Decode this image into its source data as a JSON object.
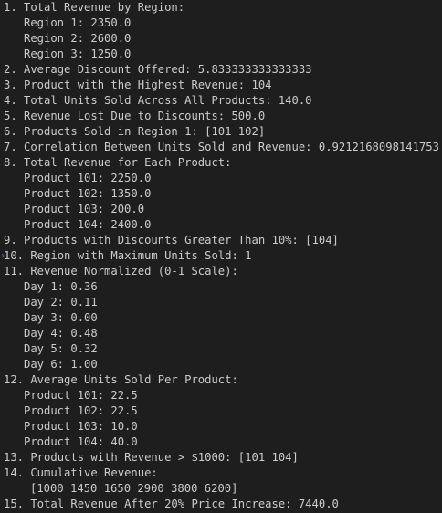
{
  "terminal": {
    "lines": [
      {
        "text": "1. Total Revenue by Region:",
        "indent": 0
      },
      {
        "text": "Region 1: 2350.0",
        "indent": 1
      },
      {
        "text": "Region 2: 2600.0",
        "indent": 1
      },
      {
        "text": "Region 3: 1250.0",
        "indent": 1
      },
      {
        "text": "2. Average Discount Offered: 5.833333333333333",
        "indent": 0
      },
      {
        "text": "3. Product with the Highest Revenue: 104",
        "indent": 0
      },
      {
        "text": "4. Total Units Sold Across All Products: 140.0",
        "indent": 0
      },
      {
        "text": "5. Revenue Lost Due to Discounts: 500.0",
        "indent": 0
      },
      {
        "text": "6. Products Sold in Region 1: [101 102]",
        "indent": 0
      },
      {
        "text": "7. Correlation Between Units Sold and Revenue: 0.9212168098141753",
        "indent": 0
      },
      {
        "text": "8. Total Revenue for Each Product:",
        "indent": 0
      },
      {
        "text": "Product 101: 2250.0",
        "indent": 1
      },
      {
        "text": "Product 102: 1350.0",
        "indent": 1
      },
      {
        "text": "Product 103: 200.0",
        "indent": 1
      },
      {
        "text": "Product 104: 2400.0",
        "indent": 1
      },
      {
        "text": "9. Products with Discounts Greater Than 10%: [104]",
        "indent": 0
      },
      {
        "text": "10. Region with Maximum Units Sold: 1",
        "indent": 0,
        "marker": true
      },
      {
        "text": "11. Revenue Normalized (0-1 Scale):",
        "indent": 0
      },
      {
        "text": "Day 1: 0.36",
        "indent": 1
      },
      {
        "text": "Day 2: 0.11",
        "indent": 1
      },
      {
        "text": "Day 3: 0.00",
        "indent": 1
      },
      {
        "text": "Day 4: 0.48",
        "indent": 1
      },
      {
        "text": "Day 5: 0.32",
        "indent": 1
      },
      {
        "text": "Day 6: 1.00",
        "indent": 1
      },
      {
        "text": "12. Average Units Sold Per Product:",
        "indent": 0
      },
      {
        "text": "Product 101: 22.5",
        "indent": 1
      },
      {
        "text": "Product 102: 22.5",
        "indent": 1
      },
      {
        "text": "Product 103: 10.0",
        "indent": 1
      },
      {
        "text": "Product 104: 40.0",
        "indent": 1
      },
      {
        "text": "13. Products with Revenue > $1000: [101 104]",
        "indent": 0
      },
      {
        "text": "14. Cumulative Revenue:",
        "indent": 0
      },
      {
        "text": "[1000 1450 1650 2900 3800 6200]",
        "indent": 2
      },
      {
        "text": "15. Total Revenue After 20% Price Increase: 7440.0",
        "indent": 0
      }
    ],
    "marker_glyph": "›",
    "colors": {
      "background": "#1e1e1e",
      "text": "#cccccc",
      "marker": "#3c8ad8"
    }
  }
}
